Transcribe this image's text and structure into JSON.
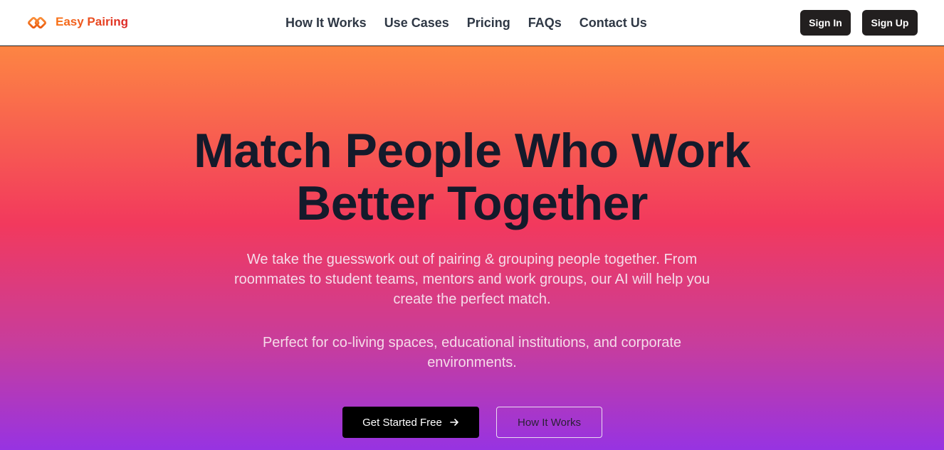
{
  "brand": {
    "name": "Easy Pairing",
    "icon": "linked-diamonds-icon"
  },
  "nav": {
    "links": [
      "How It Works",
      "Use Cases",
      "Pricing",
      "FAQs",
      "Contact Us"
    ],
    "sign_in": "Sign In",
    "sign_up": "Sign Up"
  },
  "hero": {
    "title_line1": "Match People Who Work",
    "title_line2": "Better Together",
    "description": "We take the guesswork out of pairing & grouping people together. From roommates to student teams, mentors and work groups, our AI will help you create the perfect match.",
    "subdescription": "Perfect for co-living spaces, educational institutions, and corporate environments.",
    "primary_cta": "Get Started Free",
    "primary_cta_icon": "arrow-right-icon",
    "secondary_cta": "How It Works"
  },
  "colors": {
    "brand_orange": "#f97316",
    "gradient_top": "#fd8543",
    "gradient_mid": "#f2395d",
    "gradient_bottom": "#9733e2",
    "dark_button": "#221f1f"
  }
}
